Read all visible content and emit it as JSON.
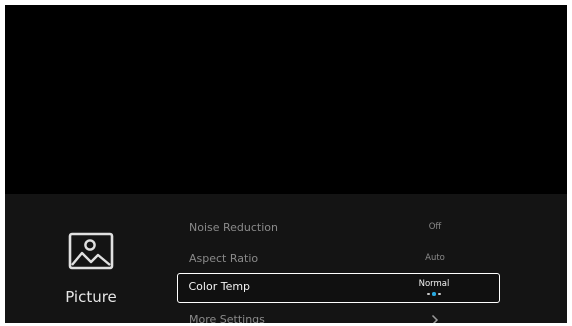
{
  "category": {
    "label": "Picture",
    "icon": "picture-icon"
  },
  "settings": [
    {
      "label": "Noise Reduction",
      "value": "Off"
    },
    {
      "label": "Aspect Ratio",
      "value": "Auto"
    },
    {
      "label": "Color Temp",
      "value": "Normal",
      "focused": true,
      "options_count": 3,
      "selected_option_index": 1
    },
    {
      "label": "More Settings",
      "icon": "chevron-right-icon"
    }
  ],
  "colors": {
    "screen_background": "#000000",
    "menu_background": "#141414",
    "focus_border": "#ffffff",
    "selected_dot": "#29a9e0"
  }
}
